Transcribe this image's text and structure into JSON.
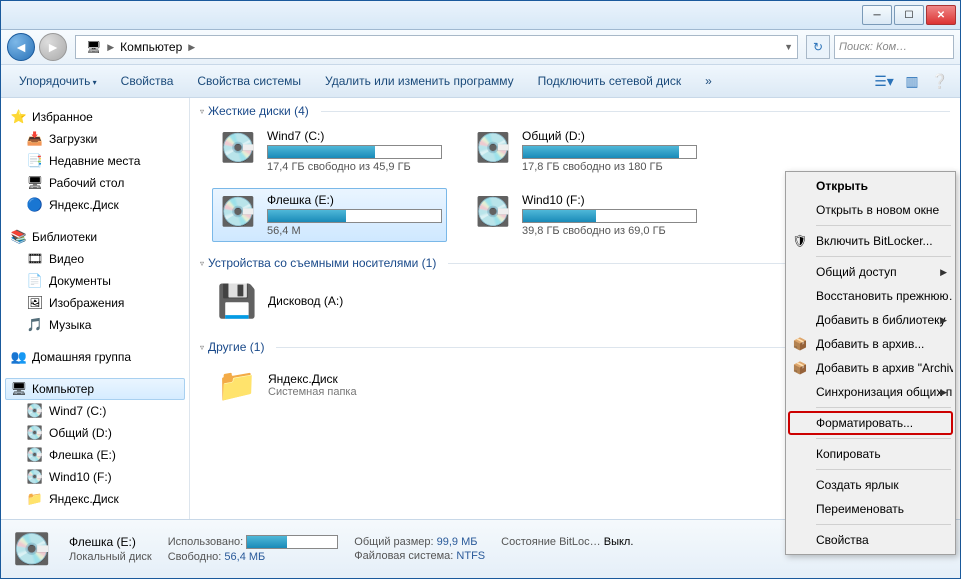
{
  "titlebar": {},
  "nav": {
    "crumb_root_icon": "🖥",
    "crumb1": "Компьютер",
    "search_placeholder": "Поиск: Ком…"
  },
  "toolbar": {
    "organize": "Упорядочить",
    "properties": "Свойства",
    "sys_properties": "Свойства системы",
    "uninstall": "Удалить или изменить программу",
    "map_drive": "Подключить сетевой диск",
    "overflow": "»"
  },
  "sidebar": {
    "favorites": {
      "label": "Избранное",
      "items": [
        {
          "icon": "📥",
          "label": "Загрузки"
        },
        {
          "icon": "📑",
          "label": "Недавние места"
        },
        {
          "icon": "🖥",
          "label": "Рабочий стол"
        },
        {
          "icon": "🔵",
          "label": "Яндекс.Диск"
        }
      ]
    },
    "libraries": {
      "label": "Библиотеки",
      "items": [
        {
          "icon": "🎞",
          "label": "Видео"
        },
        {
          "icon": "📄",
          "label": "Документы"
        },
        {
          "icon": "🖼",
          "label": "Изображения"
        },
        {
          "icon": "🎵",
          "label": "Музыка"
        }
      ]
    },
    "homegroup": {
      "label": "Домашняя группа"
    },
    "computer": {
      "label": "Компьютер",
      "items": [
        {
          "icon": "💽",
          "label": "Wind7 (C:)"
        },
        {
          "icon": "💽",
          "label": "Общий (D:)"
        },
        {
          "icon": "💽",
          "label": "Флешка (E:)"
        },
        {
          "icon": "💽",
          "label": "Wind10 (F:)"
        },
        {
          "icon": "📁",
          "label": "Яндекс.Диск"
        }
      ]
    }
  },
  "sections": {
    "hdd": {
      "title": "Жесткие диски (4)"
    },
    "removable": {
      "title": "Устройства со съемными носителями (1)"
    },
    "other": {
      "title": "Другие (1)"
    }
  },
  "drives": [
    {
      "name": "Wind7 (C:)",
      "sub": "17,4 ГБ свободно из 45,9 ГБ",
      "fill": 62
    },
    {
      "name": "Общий (D:)",
      "sub": "17,8 ГБ свободно из 180 ГБ",
      "fill": 90
    },
    {
      "name": "Флешка (E:)",
      "sub": "56,4 М",
      "fill": 45,
      "sel": true
    },
    {
      "name": "Wind10 (F:)",
      "sub": "39,8 ГБ свободно из 69,0 ГБ",
      "fill": 42
    }
  ],
  "removable": {
    "name": "Дисковод (A:)"
  },
  "other": {
    "name": "Яндекс.Диск",
    "sub": "Системная папка"
  },
  "status": {
    "title": "Флешка (E:)",
    "subtitle": "Локальный диск",
    "used_label": "Использовано:",
    "free_label": "Свободно:",
    "free_val": "56,4 МБ",
    "total_label": "Общий размер:",
    "total_val": "99,9 МБ",
    "fs_label": "Файловая система:",
    "fs_val": "NTFS",
    "bl_label": "Состояние BitLoc…",
    "bl_val": "Выкл.",
    "bar_fill": 44
  },
  "ctx": {
    "open": "Открыть",
    "open_new": "Открыть в новом окне",
    "bitlocker": "Включить BitLocker...",
    "share": "Общий доступ",
    "restore": "Восстановить прежнюю…",
    "add_lib": "Добавить в библиотеку",
    "add_arch": "Добавить в архив...",
    "add_arch2": "Добавить в архив \"Archiv…",
    "sync": "Синхронизация общих п…",
    "format": "Форматировать...",
    "copy": "Копировать",
    "shortcut": "Создать ярлык",
    "rename": "Переименовать",
    "props": "Свойства"
  }
}
